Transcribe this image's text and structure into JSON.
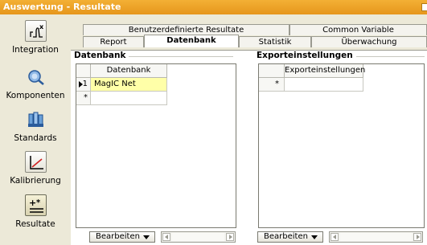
{
  "window": {
    "title": "Auswertung - Resultate"
  },
  "nav": [
    {
      "label": "Integration",
      "icon": "integration-icon"
    },
    {
      "label": "Komponenten",
      "icon": "komponenten-icon"
    },
    {
      "label": "Standards",
      "icon": "standards-icon"
    },
    {
      "label": "Kalibrierung",
      "icon": "kalibrierung-icon"
    },
    {
      "label": "Resultate",
      "icon": "resultate-icon",
      "active": true
    }
  ],
  "tabs": {
    "top_row": [
      "Benutzerdefinierte Resultate",
      "Common Variable"
    ],
    "bottom_row": [
      "Report",
      "Datenbank",
      "Statistik",
      "Überwachung"
    ],
    "active": "Datenbank"
  },
  "datenbank": {
    "title": "Datenbank",
    "column": "Datenbank",
    "rows": [
      {
        "num": "1",
        "value": "MagIC Net"
      }
    ],
    "new_row_marker": "*",
    "edit_button": "Bearbeiten"
  },
  "export": {
    "title": "Exporteinstellungen",
    "column": "Exporteinstellungen",
    "new_row_marker": "*",
    "edit_button": "Bearbeiten"
  },
  "colors": {
    "title_bar": "#e8a024",
    "selection": "#ffffa8"
  }
}
